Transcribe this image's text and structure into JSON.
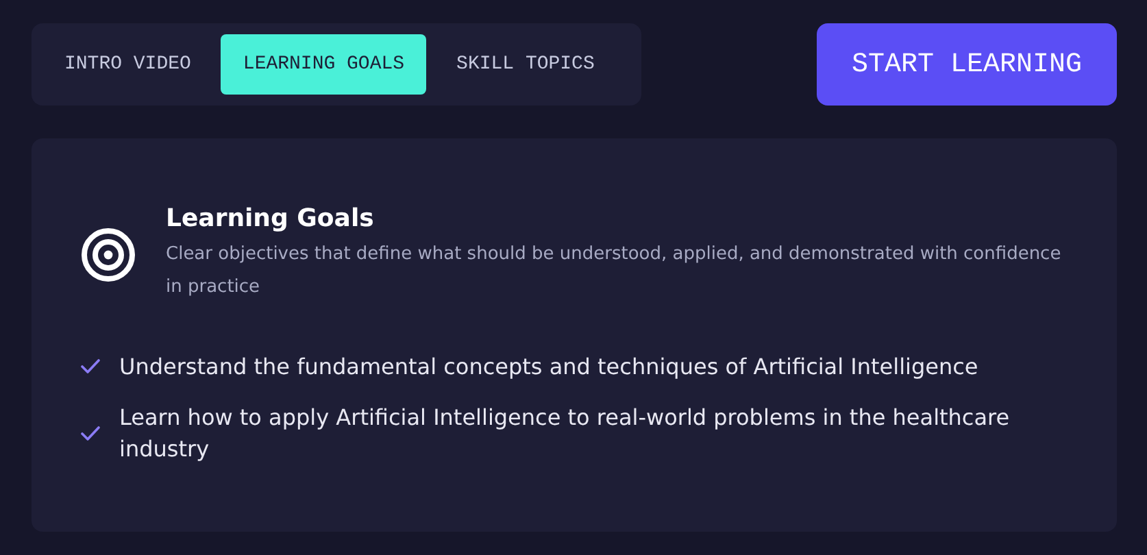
{
  "tabs": [
    {
      "label": "INTRO VIDEO",
      "selected": false
    },
    {
      "label": "LEARNING GOALS",
      "selected": true
    },
    {
      "label": "SKILL TOPICS",
      "selected": false
    }
  ],
  "start_button": "START LEARNING",
  "panel": {
    "title": "Learning Goals",
    "description": "Clear objectives that define what should be understood, applied, and demonstrated with confidence in practice",
    "goals": [
      "Understand the fundamental concepts and techniques of Artificial Intelligence",
      "Learn how to apply Artificial Intelligence to real-world problems in the healthcare industry"
    ]
  }
}
